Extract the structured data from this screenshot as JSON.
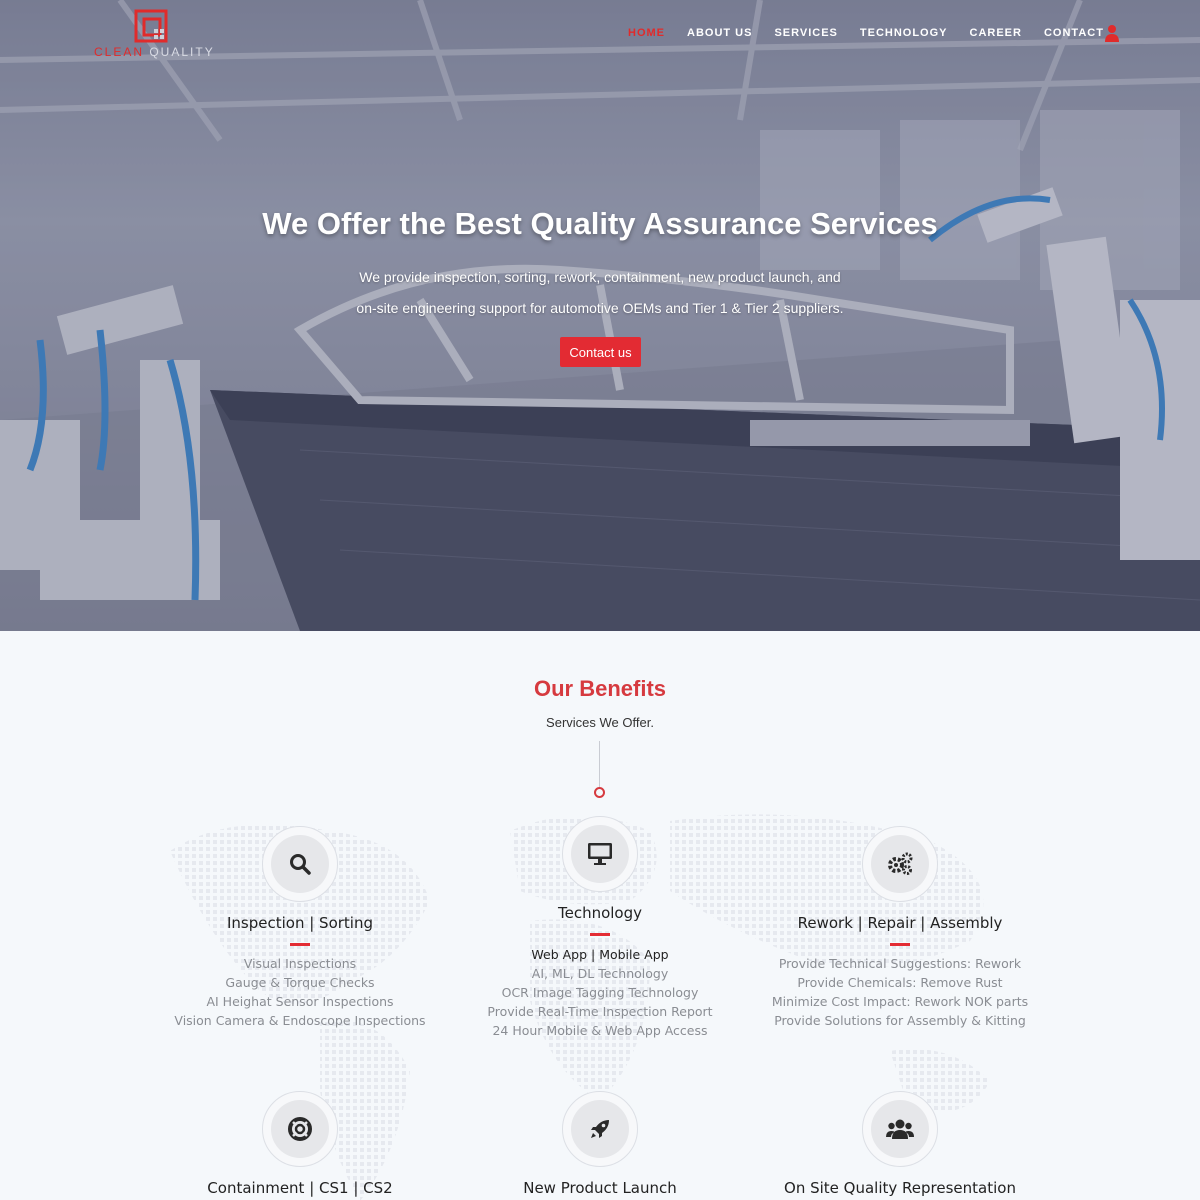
{
  "brand": {
    "name_part1": "CLEAN",
    "name_part2": " QUALITY",
    "accent_color": "#e02b2b"
  },
  "nav": {
    "items": [
      {
        "label": "HOME",
        "active": true
      },
      {
        "label": "ABOUT US",
        "active": false
      },
      {
        "label": "SERVICES",
        "active": false
      },
      {
        "label": "TECHNOLOGY",
        "active": false
      },
      {
        "label": "CAREER",
        "active": false
      },
      {
        "label": "CONTACT",
        "active": false
      }
    ],
    "user_icon": "user-icon"
  },
  "hero": {
    "title": "We Offer the Best Quality Assurance Services",
    "subtitle_line1": "We provide inspection, sorting, rework, containment, new product launch, and",
    "subtitle_line2": "on-site engineering support for automotive OEMs and Tier 1 & Tier 2 suppliers.",
    "cta_label": "Contact us"
  },
  "benefits": {
    "title": "Our Benefits",
    "subtitle": "Services We Offer.",
    "cards": [
      {
        "title": "Inspection | Sorting",
        "icon": "search-icon",
        "items": [
          "Visual Inspections",
          "Gauge & Torque Checks",
          "AI Heighat Sensor Inspections",
          "Vision Camera & Endoscope Inspections"
        ]
      },
      {
        "title": "Technology",
        "icon": "monitor-icon",
        "items": [
          "Web App | Mobile App",
          "AI, ML, DL Technology",
          "OCR Image Tagging Technology",
          "Provide Real-Time Inspection Report",
          "24 Hour Mobile & Web App Access"
        ]
      },
      {
        "title": "Rework | Repair | Assembly",
        "icon": "gears-icon",
        "items": [
          "Provide Technical Suggestions: Rework",
          "Provide Chemicals: Remove Rust",
          "Minimize Cost Impact: Rework NOK parts",
          "Provide Solutions for Assembly & Kitting"
        ]
      },
      {
        "title": "Containment | CS1 | CS2",
        "icon": "life-ring-icon"
      },
      {
        "title": "New Product Launch",
        "icon": "rocket-icon"
      },
      {
        "title": "On Site Quality Representation",
        "icon": "users-icon"
      }
    ]
  }
}
